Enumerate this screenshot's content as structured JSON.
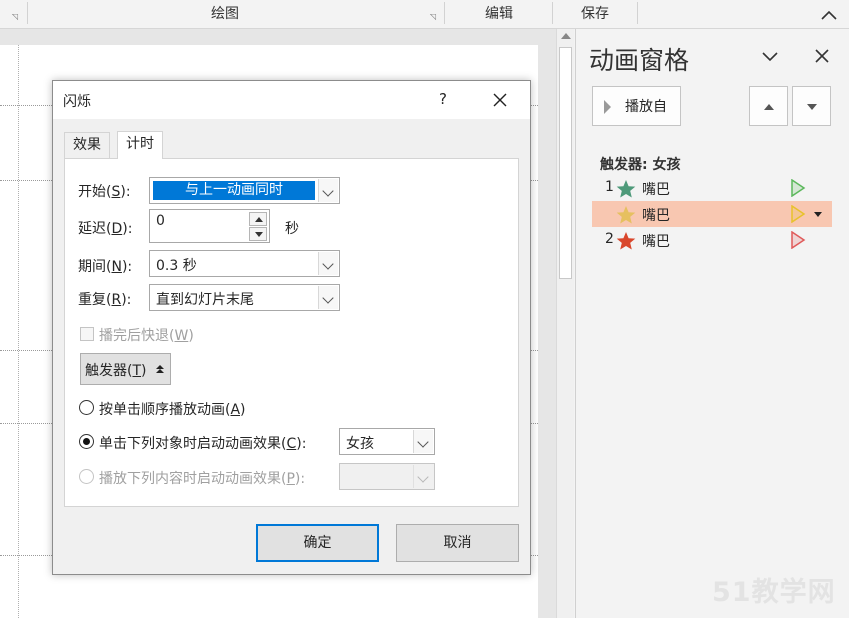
{
  "ribbon": {
    "groups": [
      "绘图",
      "编辑",
      "保存"
    ]
  },
  "pane": {
    "title": "动画窗格",
    "play_label": "播放自",
    "trigger_header": "触发器: 女孩",
    "items": [
      {
        "num": "1",
        "name": "嘴巴",
        "star_color": "#4e9a7a",
        "line_color": "#5cb85c"
      },
      {
        "num": "",
        "name": "嘴巴",
        "star_color": "#e6c060",
        "line_color": "#e8c22c"
      },
      {
        "num": "2",
        "name": "嘴巴",
        "star_color": "#d9462b",
        "line_color": "#e05a5a"
      }
    ],
    "selected_color": "#f8c7b1"
  },
  "dialog": {
    "title": "闪烁",
    "help": "?",
    "tabs": [
      "效果",
      "计时"
    ],
    "start": {
      "label": "开始(",
      "key": "S",
      "end": "):",
      "value": "与上一动画同时"
    },
    "delay": {
      "label": "延迟(",
      "key": "D",
      "end": "):",
      "value": "0",
      "unit": "秒"
    },
    "duration": {
      "label": "期间(",
      "key": "N",
      "end": "):",
      "value": "0.3 秒"
    },
    "repeat": {
      "label": "重复(",
      "key": "R",
      "end": "):",
      "value": "直到幻灯片末尾"
    },
    "rewind": {
      "label": "播完后快退(",
      "key": "W",
      "end": ")"
    },
    "trigger_btn": {
      "label": "触发器(",
      "key": "T",
      "end": ")"
    },
    "radio1": {
      "label": "按单击顺序播放动画(",
      "key": "A",
      "end": ")"
    },
    "radio2": {
      "label": "单击下列对象时启动动画效果(",
      "key": "C",
      "end": "):",
      "value": "女孩"
    },
    "radio3": {
      "label": "播放下列内容时启动动画效果(",
      "key": "P",
      "end": "):"
    },
    "ok": "确定",
    "cancel": "取消"
  },
  "watermark": "51教学网",
  "colors": {
    "accent": "#0078d7"
  }
}
